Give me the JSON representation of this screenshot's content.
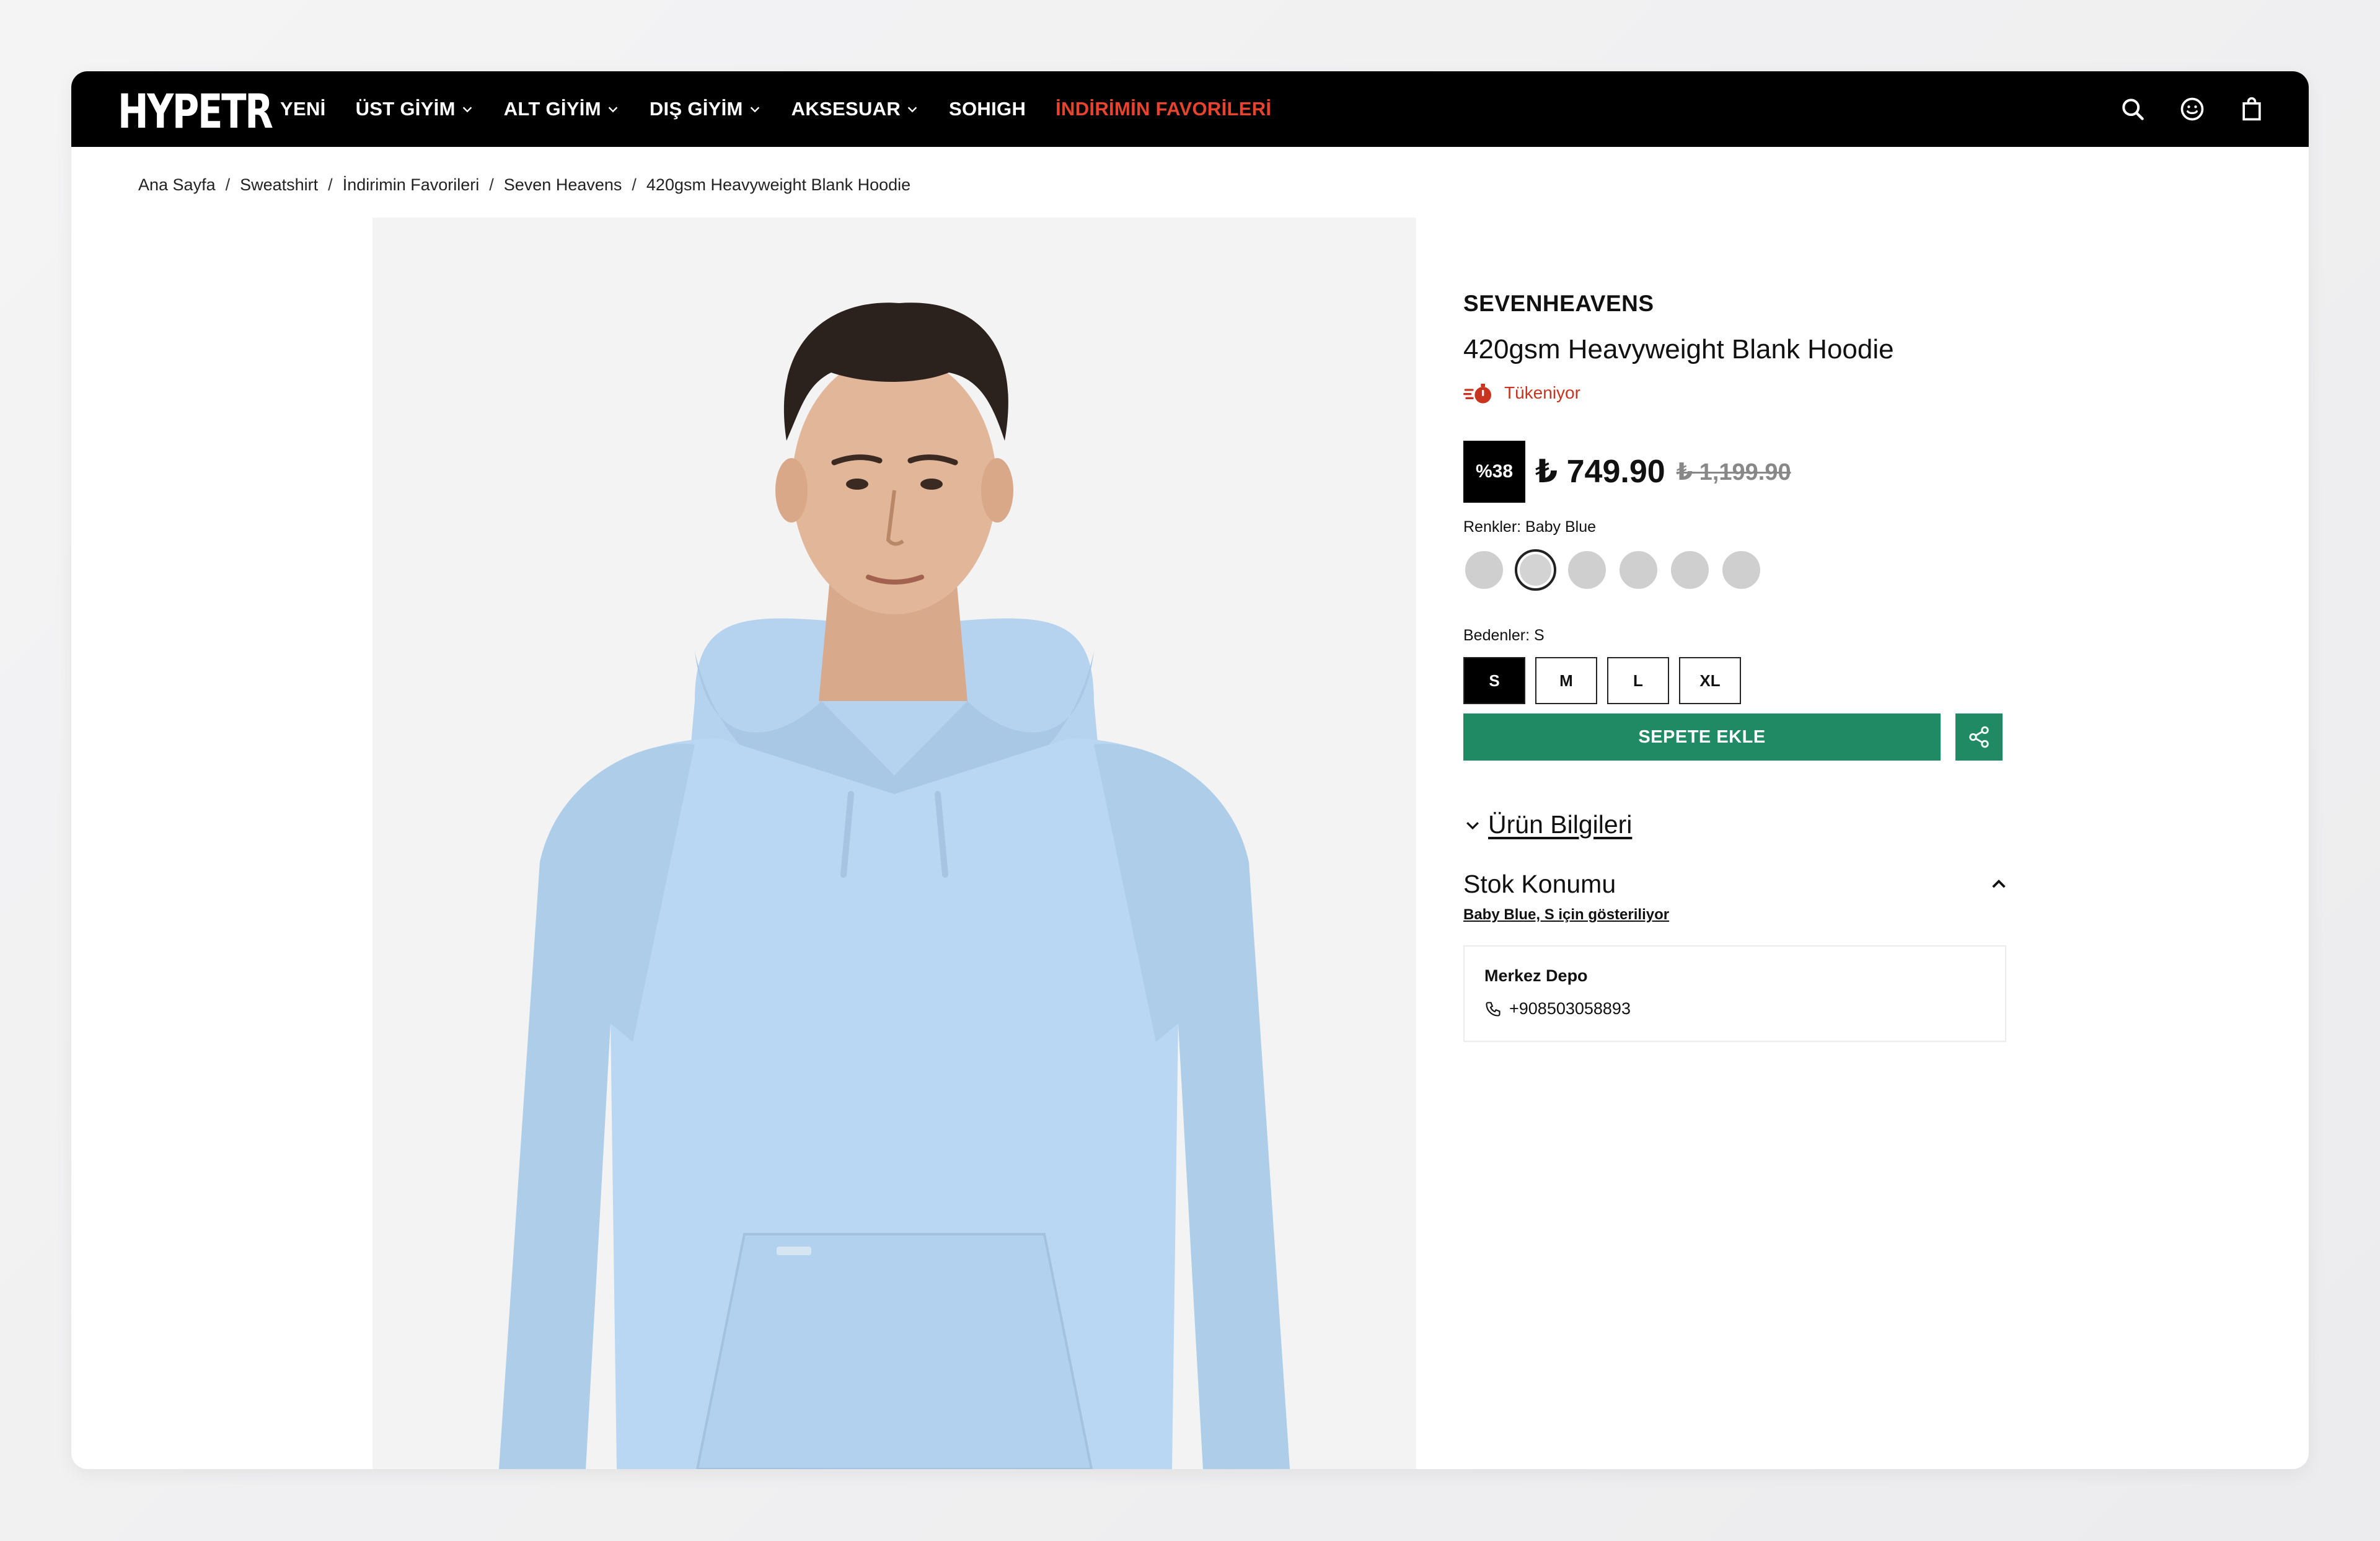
{
  "nav": {
    "logo": "HYPETR",
    "menu": [
      {
        "label": "YENİ",
        "dropdown": false
      },
      {
        "label": "ÜST GİYİM",
        "dropdown": true
      },
      {
        "label": "ALT GİYİM",
        "dropdown": true
      },
      {
        "label": "DIŞ GİYİM",
        "dropdown": true
      },
      {
        "label": "AKSESUAR",
        "dropdown": true
      },
      {
        "label": "SOHIGH",
        "dropdown": false
      },
      {
        "label": "İNDİRİMİN FAVORİLERİ",
        "dropdown": false,
        "highlight": true
      }
    ],
    "icons": [
      "search-icon",
      "account-icon",
      "bag-icon"
    ]
  },
  "breadcrumb": [
    "Ana Sayfa",
    "Sweatshirt",
    "İndirimin Favorileri",
    "Seven Heavens",
    "420gsm Heavyweight Blank Hoodie"
  ],
  "product": {
    "brand": "SEVENHEAVENS",
    "title": "420gsm Heavyweight Blank Hoodie",
    "stock_badge": "Tükeniyor",
    "discount": "%38",
    "price": "₺ 749.90",
    "old_price": "₺ 1,199.90",
    "colors_label": "Renkler: Baby Blue",
    "swatch_count": 6,
    "selected_swatch_index": 1,
    "sizes_label": "Bedenler: S",
    "sizes": [
      "S",
      "M",
      "L",
      "XL"
    ],
    "selected_size": "S",
    "add_to_cart": "SEPETE EKLE"
  },
  "info_accordion": {
    "label": "Ürün Bilgileri"
  },
  "stock_location": {
    "title": "Stok Konumu",
    "subtitle": "Baby Blue, S için gösteriliyor",
    "store_name": "Merkez Depo",
    "phone": "+908503058893"
  },
  "colors": {
    "nav_bg": "#000000",
    "highlight": "#e8432e",
    "accent_green": "#1f8a63",
    "hoodie": "#b9d7f2",
    "stock_red": "#c8341f"
  }
}
